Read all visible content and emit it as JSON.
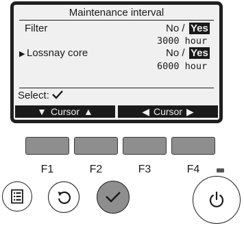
{
  "screen": {
    "title": "Maintenance interval",
    "rows": [
      {
        "label": "Filter",
        "value": "No /",
        "selected": "Yes",
        "hours": "3000 hour"
      },
      {
        "cursor": "▶",
        "label": "Lossnay core",
        "value": "No /",
        "selected": "Yes",
        "hours": "6000 hour"
      }
    ],
    "select_label": "Select:",
    "select_icon": "check-icon",
    "softkeys": [
      {
        "left_icon": "▼",
        "label": "Cursor",
        "right_icon": "▲"
      },
      {
        "left_icon": "◀",
        "label": "Cursor",
        "right_icon": "▶"
      }
    ]
  },
  "function_keys": [
    "F1",
    "F2",
    "F3",
    "F4"
  ],
  "buttons": {
    "menu": "menu-icon",
    "return": "return-icon",
    "select": "check-icon",
    "power": "power-icon"
  },
  "colors": {
    "screen_bg": "#f0f0f0",
    "bezel": "#1f1f1f",
    "fkey": "#8e8e8e",
    "select_button": "#8e8e8e"
  }
}
